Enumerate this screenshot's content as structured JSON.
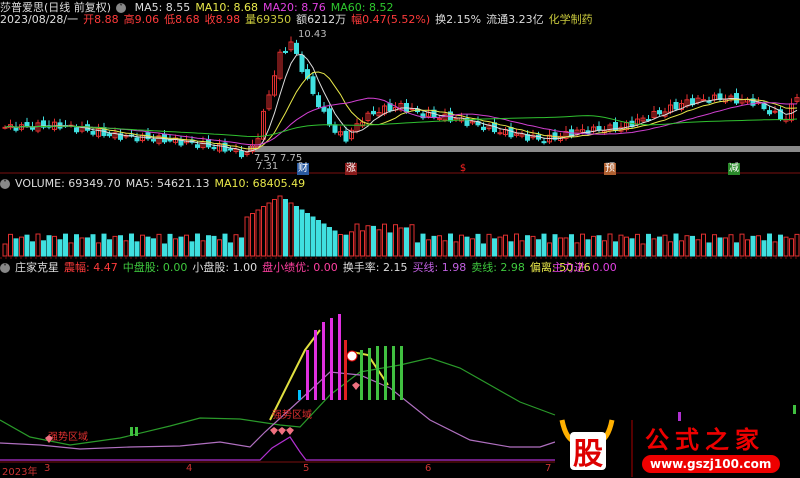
{
  "header": {
    "stock": "莎普爱思(日线 前复权)",
    "ma5": "MA5: 8.55",
    "ma10": "MA10: 8.68",
    "ma20": "MA20: 8.76",
    "ma60": "MA60: 8.52"
  },
  "quote": {
    "date": "2023/08/28/一",
    "open": "开8.88",
    "high": "高9.06",
    "low": "低8.68",
    "close": "收8.98",
    "vol": "量69350",
    "amount": "额6212万",
    "change": "幅0.47(5.52%)",
    "turnover": "换2.15%",
    "float": "流通3.23亿",
    "sector": "化学制药"
  },
  "price_labels": {
    "high": "10.43",
    "low": "7.31",
    "l1": "7.57",
    "l2": "7.75"
  },
  "event_tags": [
    {
      "label": "财",
      "color": "#2a5aa0"
    },
    {
      "label": "涨",
      "color": "#8a1a1a"
    },
    {
      "label": "$",
      "color": "#c00"
    },
    {
      "label": "预",
      "color": "#b06030"
    },
    {
      "label": "减",
      "color": "#2a8a2a"
    }
  ],
  "volume": {
    "vol": "VOLUME: 69349.70",
    "ma5": "MA5: 54621.13",
    "ma10": "MA10: 68405.49"
  },
  "indicator": {
    "name": "庄家克星",
    "zhenfu": "震幅: 4.47",
    "zhongpan": "中盘股: 0.00",
    "xiaopan": "小盘股: 1.00",
    "panxiao": "盘小绩优: 0.00",
    "huanshou": "换手率: 2.15",
    "mai": "买线: 1.98",
    "maix": "卖线: 2.98",
    "pianli": "偏离: 50.76",
    "zhuli": "主力进: 0.00",
    "zone1": "强势区域",
    "zone2": "强势区域"
  },
  "xaxis": [
    "2023年",
    "3",
    "4",
    "5",
    "6",
    "7"
  ],
  "watermark": {
    "logo": "股",
    "title": "公式之家",
    "url": "www.gszj100.com"
  },
  "price_path": [
    [
      0,
      8.2
    ],
    [
      10,
      8.25
    ],
    [
      20,
      8.0
    ],
    [
      30,
      7.9
    ],
    [
      40,
      7.7
    ],
    [
      44,
      7.55
    ],
    [
      46,
      8.0
    ],
    [
      48,
      9.0
    ],
    [
      50,
      9.9
    ],
    [
      52,
      10.2
    ],
    [
      54,
      9.6
    ],
    [
      56,
      9.0
    ],
    [
      58,
      8.5
    ],
    [
      60,
      8.1
    ],
    [
      62,
      7.95
    ],
    [
      65,
      8.4
    ],
    [
      68,
      8.6
    ],
    [
      72,
      8.7
    ],
    [
      76,
      8.5
    ],
    [
      82,
      8.4
    ],
    [
      90,
      8.1
    ],
    [
      98,
      7.9
    ],
    [
      104,
      8.1
    ],
    [
      112,
      8.2
    ],
    [
      118,
      8.5
    ],
    [
      124,
      8.8
    ],
    [
      130,
      8.9
    ],
    [
      136,
      8.8
    ],
    [
      140,
      8.5
    ],
    [
      142,
      8.4
    ],
    [
      144,
      8.98
    ]
  ]
}
